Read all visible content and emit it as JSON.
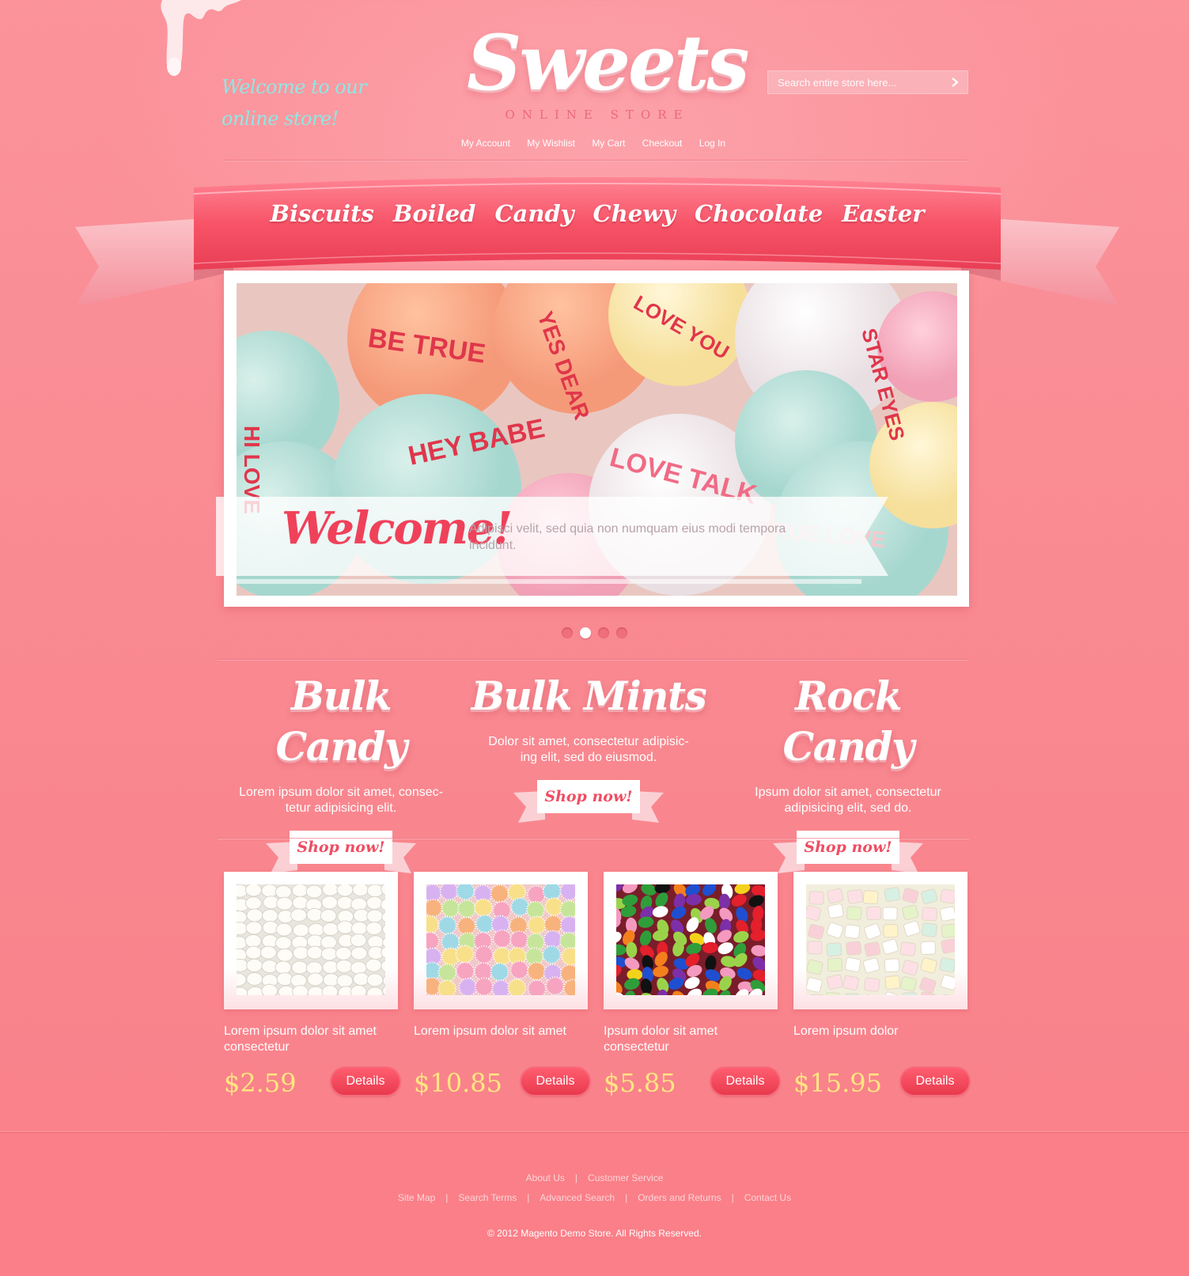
{
  "header": {
    "welcome_message": "Welcome to our online store!",
    "logo_title": "Sweets",
    "logo_subtitle": "ONLINE STORE",
    "search_placeholder": "Search entire store here...",
    "top_links": [
      "My Account",
      "My Wishlist",
      "My Cart",
      "Checkout",
      "Log In"
    ]
  },
  "nav": {
    "items": [
      "Biscuits",
      "Boiled",
      "Candy",
      "Chewy",
      "Chocolate",
      "Easter"
    ]
  },
  "slider": {
    "title": "Welcome!",
    "text": "Adipisci velit, sed quia non numquam eius modi tempora incidunt.",
    "candy_messages": [
      "BE TRUE",
      "YES DEAR",
      "LOVE YOU",
      "STAR EYES",
      "HEY BABE",
      "LOVE TALK",
      "HI LOVE",
      "TRUE LOVE"
    ],
    "dots_total": 4,
    "active_dot": 2
  },
  "categories": [
    {
      "title": "Bulk Candy",
      "desc": "Lorem ipsum dolor sit amet, consec-tetur adipisicing elit.",
      "button": "Shop now!"
    },
    {
      "title": "Bulk Mints",
      "desc": "Dolor sit amet, consectetur adipisic-ing elit, sed do eiusmod.",
      "button": "Shop now!"
    },
    {
      "title": "Rock Candy",
      "desc": "Ipsum dolor sit amet, consectetur adipisicing elit, sed do.",
      "button": "Shop now!"
    }
  ],
  "products": [
    {
      "name": "Lorem ipsum dolor sit amet consectetur",
      "price": "$2.59",
      "button": "Details"
    },
    {
      "name": "Lorem ipsum dolor sit amet",
      "price": "$10.85",
      "button": "Details"
    },
    {
      "name": "Ipsum dolor sit amet consectetur",
      "price": "$5.85",
      "button": "Details"
    },
    {
      "name": "Lorem ipsum dolor",
      "price": "$15.95",
      "button": "Details"
    }
  ],
  "footer": {
    "links_row1": [
      "About Us",
      "Customer Service"
    ],
    "links_row2": [
      "Site Map",
      "Search Terms",
      "Advanced Search",
      "Orders and Returns",
      "Contact Us"
    ],
    "copyright": "© 2012 Magento Demo Store. All Rights Reserved."
  },
  "colors": {
    "background": "#f9848f",
    "accent": "#ef4d63",
    "price": "#ffe680",
    "welcome_text": "#8ee7e4"
  }
}
